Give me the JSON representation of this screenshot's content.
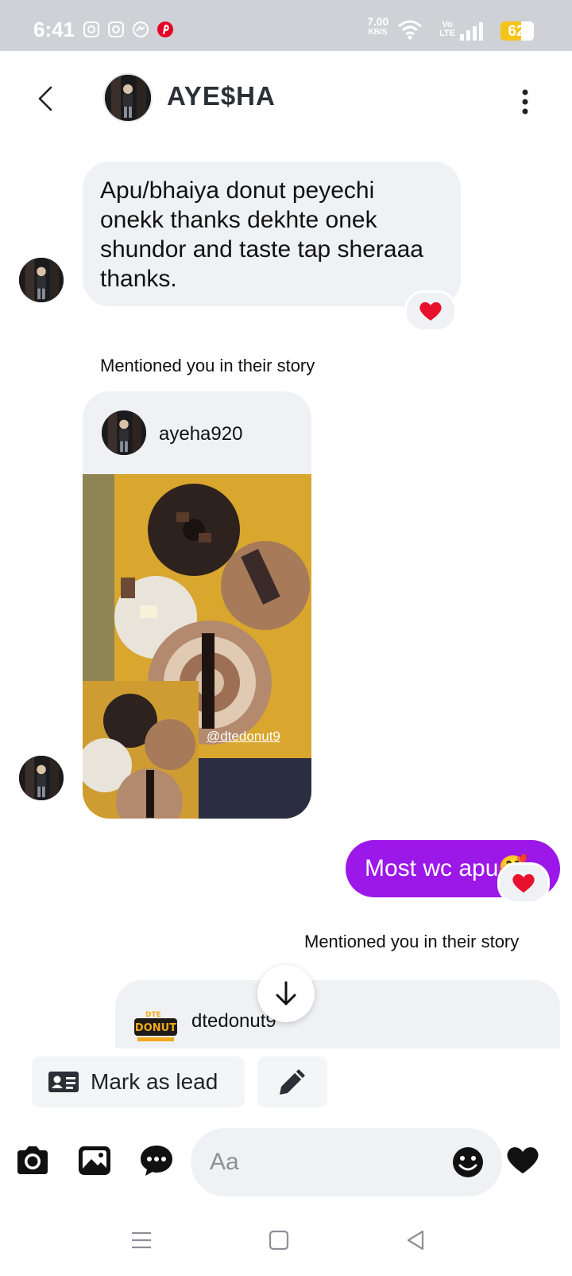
{
  "status_bar": {
    "time": "6:41",
    "net_speed": "7.00",
    "net_unit": "KB/S",
    "volte_top": "Vo",
    "volte_bottom": "LTE",
    "battery": "62",
    "battery_level": 0.62,
    "notification_icons": [
      "instagram-icon",
      "instagram-icon",
      "messenger-icon",
      "pinterest-icon"
    ]
  },
  "header": {
    "contact_name": "AYE$HA",
    "back_icon": "chevron-left-icon",
    "menu_icon": "more-vertical-icon"
  },
  "thread": {
    "message_in_1": "Apu/bhaiya donut peyechi onekk thanks dekhte onek shundor and taste tap sheraaa thanks.",
    "reaction_1": "❤️",
    "mention_label_1": "Mentioned you in their story",
    "story_1": {
      "username": "ayeha920",
      "tag": "@dtedonut9"
    },
    "message_out_1": "Most wc apu🥰",
    "reaction_2": "❤️",
    "mention_label_2": "Mentioned you in their story",
    "story_2": {
      "username": "dtedonut9"
    }
  },
  "actions": {
    "mark_as_lead": "Mark as lead"
  },
  "composer": {
    "placeholder": "Aa"
  },
  "colors": {
    "outgoing_bubble": "#9b18e8",
    "incoming_bubble": "#f0f1f4",
    "heart": "#e8112d"
  }
}
